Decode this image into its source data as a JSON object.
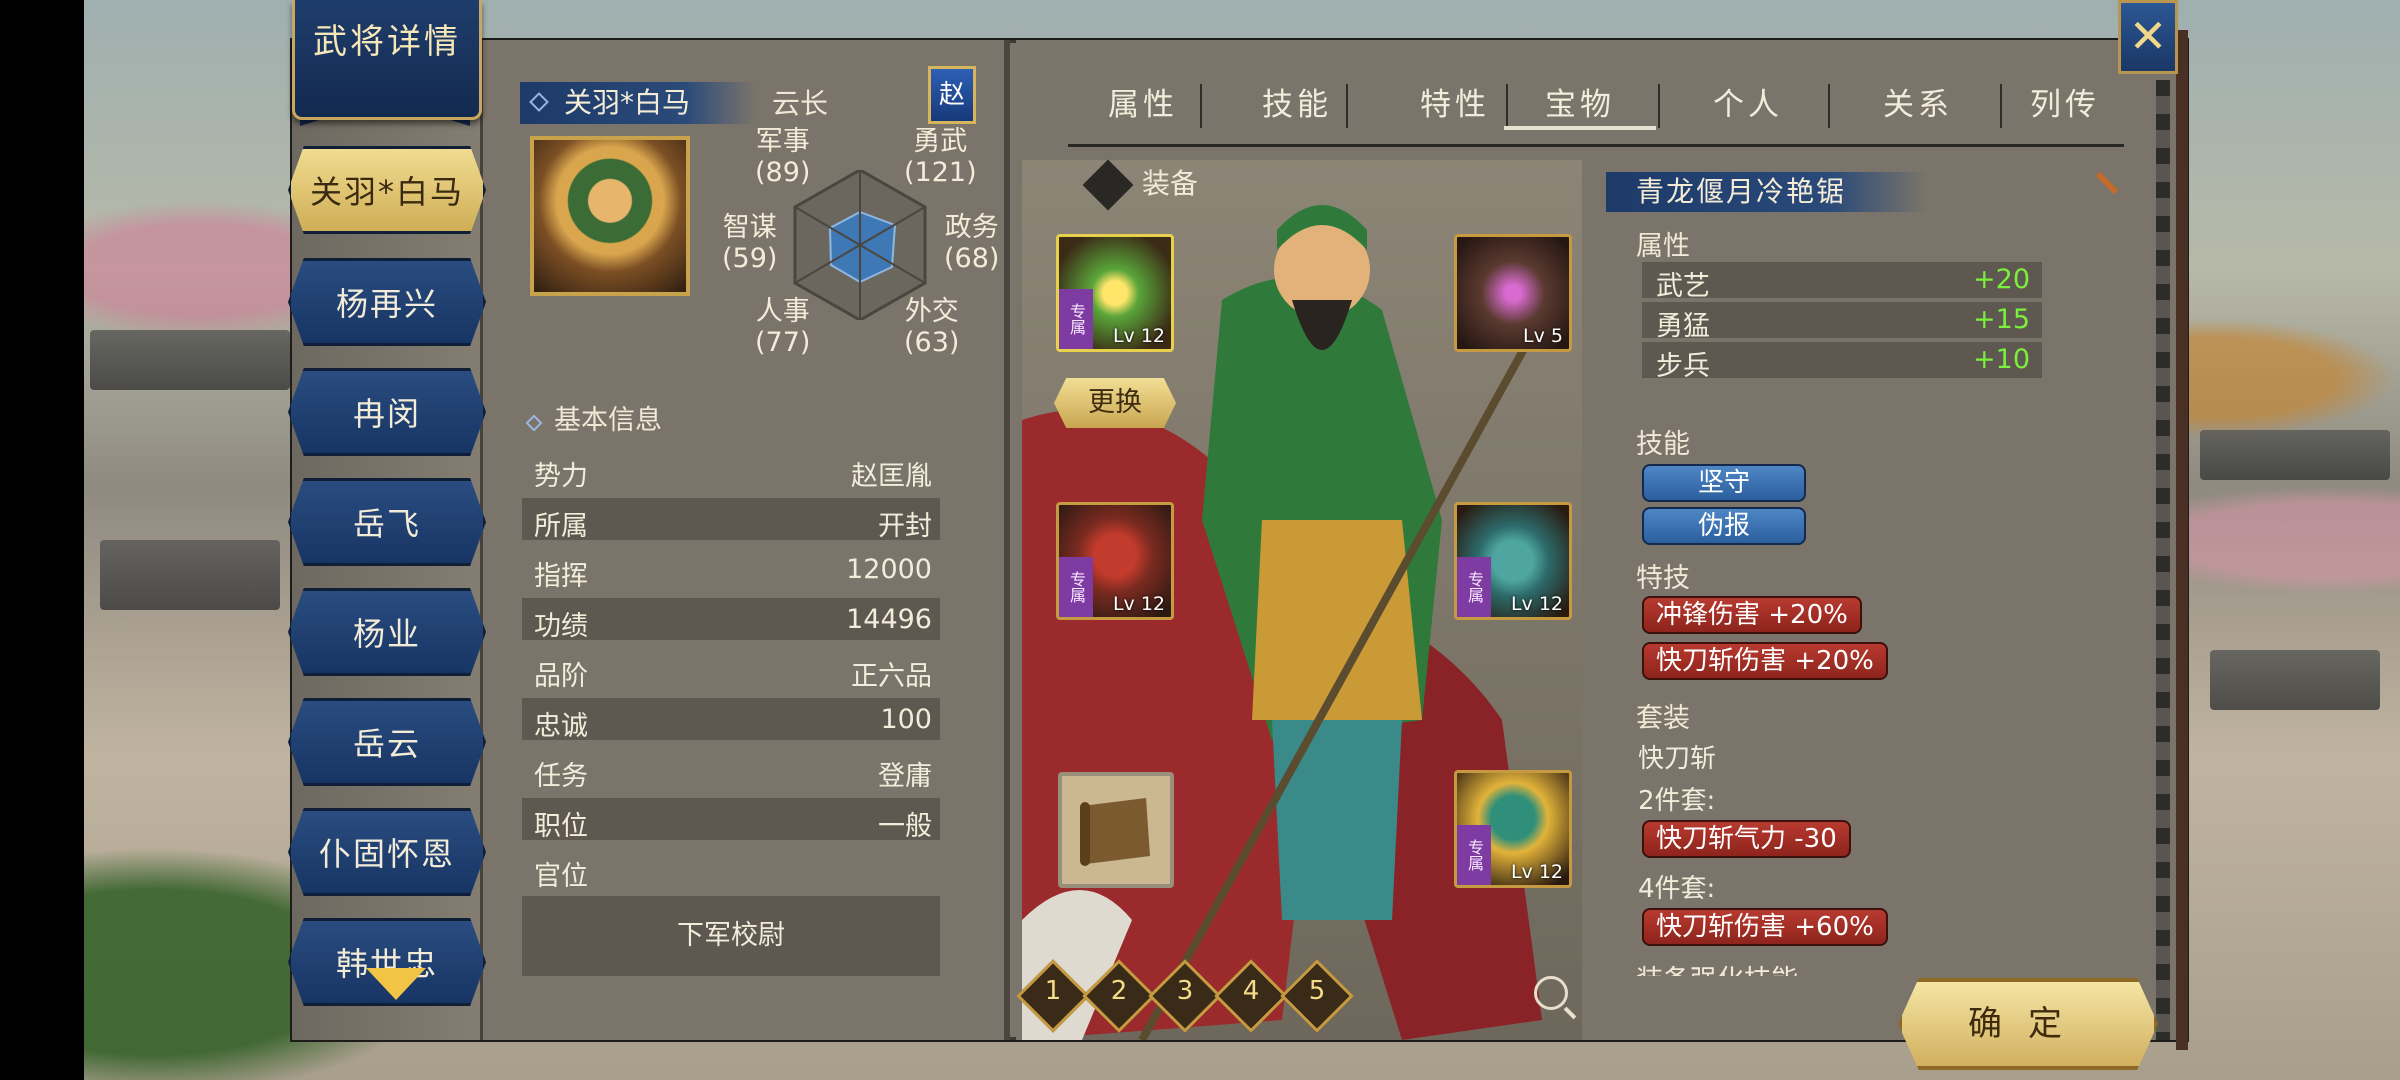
{
  "window": {
    "title": "武将详情"
  },
  "heroes": [
    {
      "name": "关羽*白马",
      "active": true
    },
    {
      "name": "杨再兴"
    },
    {
      "name": "冉闵"
    },
    {
      "name": "岳飞"
    },
    {
      "name": "杨业"
    },
    {
      "name": "岳云"
    },
    {
      "name": "仆固怀恩"
    },
    {
      "name": "韩世忠"
    }
  ],
  "general": {
    "name": "关羽*白马",
    "courtesy": "云长",
    "faction_badge": "赵",
    "stats": {
      "military": {
        "label": "军事",
        "value": "(89)"
      },
      "valor": {
        "label": "勇武",
        "value": "(121)"
      },
      "intellect": {
        "label": "智谋",
        "value": "(59)"
      },
      "politics": {
        "label": "政务",
        "value": "(68)"
      },
      "personnel": {
        "label": "人事",
        "value": "(77)"
      },
      "diplomacy": {
        "label": "外交",
        "value": "(63)"
      }
    }
  },
  "basic_info": {
    "header": "基本信息",
    "rows": [
      {
        "k": "势力",
        "v": "赵匡胤"
      },
      {
        "k": "所属",
        "v": "开封"
      },
      {
        "k": "指挥",
        "v": "12000"
      },
      {
        "k": "功绩",
        "v": "14496"
      },
      {
        "k": "品阶",
        "v": "正六品"
      },
      {
        "k": "忠诚",
        "v": "100"
      },
      {
        "k": "任务",
        "v": "登庸"
      },
      {
        "k": "职位",
        "v": "一般"
      },
      {
        "k": "官位",
        "v": ""
      }
    ],
    "office": "下军校尉"
  },
  "tabs": [
    "属性",
    "技能",
    "特性",
    "宝物",
    "个人",
    "关系",
    "列传"
  ],
  "active_tab": "宝物",
  "equipment": {
    "header": "装备",
    "replace_label": "更换",
    "exclusive_tag": "专属",
    "slots": [
      {
        "id": "weapon",
        "level": "Lv 12",
        "exclusive": true
      },
      {
        "id": "spear",
        "level": "Lv 5",
        "exclusive": false
      },
      {
        "id": "horse",
        "level": "Lv 12",
        "exclusive": true
      },
      {
        "id": "armor",
        "level": "Lv 12",
        "exclusive": true
      },
      {
        "id": "helmet",
        "level": "Lv 12",
        "exclusive": true
      }
    ],
    "pages": [
      "1",
      "2",
      "3",
      "4",
      "5"
    ]
  },
  "item_detail": {
    "title": "青龙偃月冷艳锯",
    "attributes_header": "属性",
    "attributes": [
      {
        "k": "武艺",
        "v": "+20"
      },
      {
        "k": "勇猛",
        "v": "+15"
      },
      {
        "k": "步兵",
        "v": "+10"
      }
    ],
    "skills_header": "技能",
    "skills": [
      "坚守",
      "伪报"
    ],
    "traits_header": "特技",
    "traits": [
      "冲锋伤害 +20%",
      "快刀斩伤害 +20%"
    ],
    "set_header": "套装",
    "set_name": "快刀斩",
    "set2_label": "2件套:",
    "set2_bonus": "快刀斩气力 -30",
    "set4_label": "4件套:",
    "set4_bonus": "快刀斩伤害 +60%",
    "more_label": "装备强化技能"
  },
  "confirm_label": "确定",
  "colors": {
    "accent_gold": "#d2b060",
    "panel_blue": "#1d3a68",
    "bonus_green": "#7aef3c",
    "trait_red": "#b83a30"
  }
}
